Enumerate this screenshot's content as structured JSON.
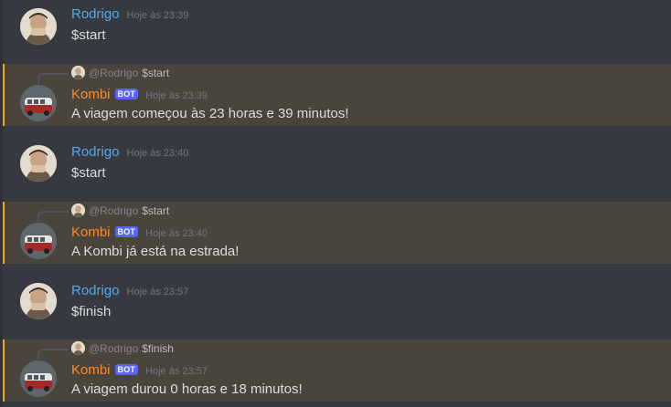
{
  "messages": [
    {
      "type": "user",
      "author": "Rodrigo",
      "timestamp": "Hoje às 23:39",
      "content": "$start"
    },
    {
      "type": "bot",
      "author": "Kombi",
      "bot_tag": "BOT",
      "timestamp": "Hoje às 23:39",
      "content": "A viagem começou às 23 horas e 39 minutos!",
      "reply": {
        "mention": "@Rodrigo",
        "text": "$start"
      }
    },
    {
      "type": "user",
      "author": "Rodrigo",
      "timestamp": "Hoje às 23:40",
      "content": "$start"
    },
    {
      "type": "bot",
      "author": "Kombi",
      "bot_tag": "BOT",
      "timestamp": "Hoje às 23:40",
      "content": "A Kombi já está na estrada!",
      "reply": {
        "mention": "@Rodrigo",
        "text": "$start"
      }
    },
    {
      "type": "user",
      "author": "Rodrigo",
      "timestamp": "Hoje às 23:57",
      "content": "$finish"
    },
    {
      "type": "bot",
      "author": "Kombi",
      "bot_tag": "BOT",
      "timestamp": "Hoje às 23:57",
      "content": "A viagem durou 0 horas e 18 minutos!",
      "reply": {
        "mention": "@Rodrigo",
        "text": "$finish"
      }
    }
  ],
  "colors": {
    "background": "#36393f",
    "highlight": "#49443c",
    "highlight_bar": "#faa81a",
    "user_name": "#5aa8e8",
    "bot_name": "#ff8a2a",
    "bot_tag": "#5865f2"
  }
}
